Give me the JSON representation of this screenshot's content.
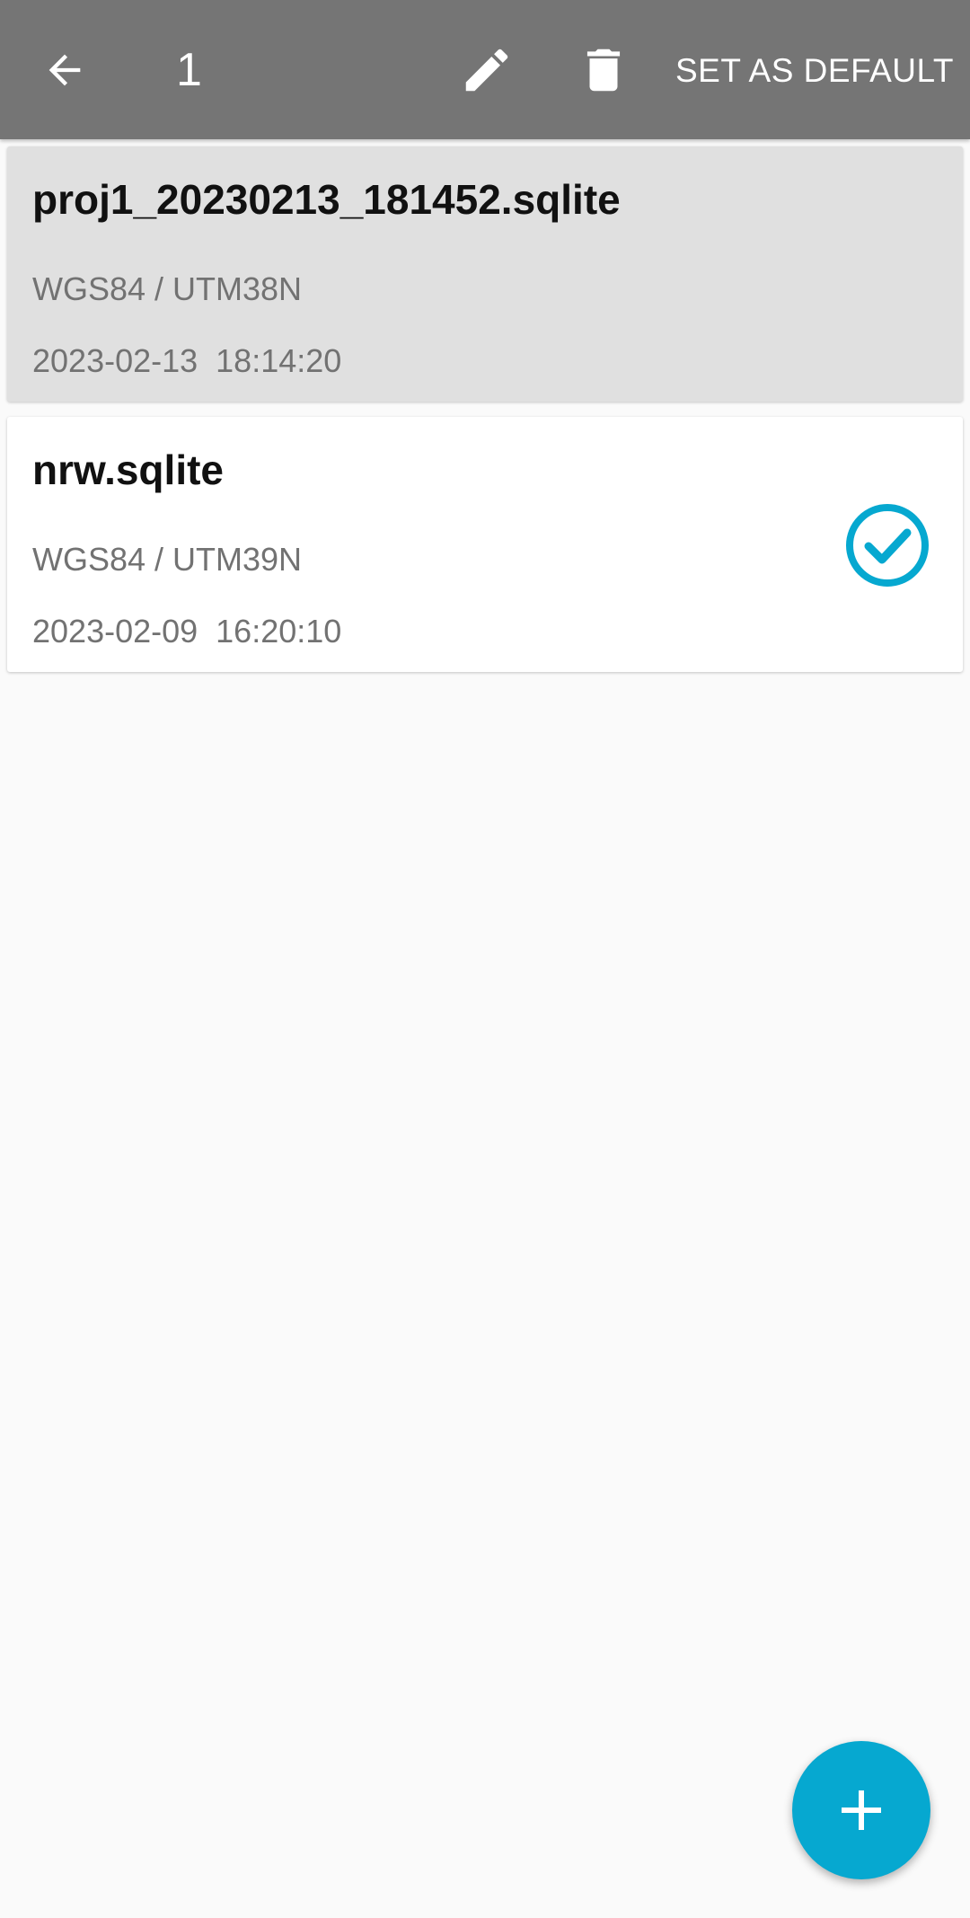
{
  "toolbar": {
    "selected_count": "1",
    "set_default_label": "SET AS DEFAULT",
    "back_icon": "arrow-back-icon",
    "edit_icon": "pencil-icon",
    "delete_icon": "trash-icon"
  },
  "projects": [
    {
      "name": "proj1_20230213_181452.sqlite",
      "crs": "WGS84 / UTM38N",
      "modified": "2023-02-13  18:14:20",
      "selected": true,
      "is_default": false
    },
    {
      "name": "nrw.sqlite",
      "crs": "WGS84 / UTM39N",
      "modified": "2023-02-09  16:20:10",
      "selected": false,
      "is_default": true
    }
  ],
  "fab": {
    "icon": "plus-icon"
  },
  "colors": {
    "appbar": "#757575",
    "accent": "#06a8d0",
    "selected_card": "#e0e0e0",
    "background": "#fafafa"
  }
}
